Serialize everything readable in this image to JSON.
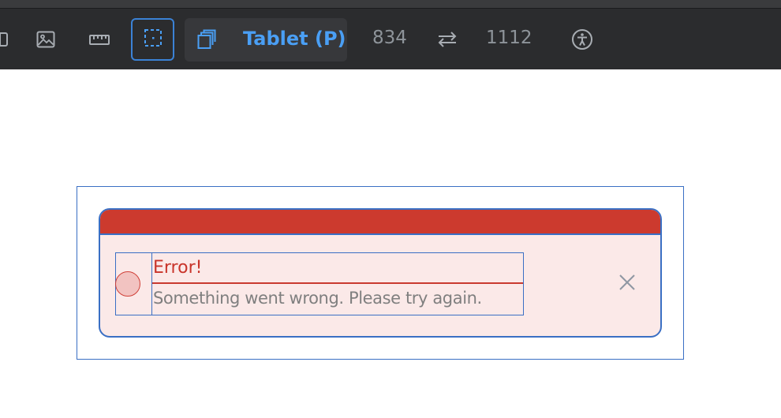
{
  "toolbar": {
    "device_name": "Tablet (P)",
    "width": "834",
    "height": "1112",
    "accent_color": "#3b82d6",
    "icons": [
      "image-icon",
      "ruler-icon",
      "select-element-icon",
      "device-frame-icon",
      "swap-dimensions-icon",
      "accessibility-icon"
    ]
  },
  "alert": {
    "title": "Error!",
    "message": "Something went wrong. Please try again.",
    "bar_color": "#cc3a2e",
    "background": "#fbe9e8",
    "icon": "status-circle-icon",
    "close_icon": "close-icon"
  }
}
